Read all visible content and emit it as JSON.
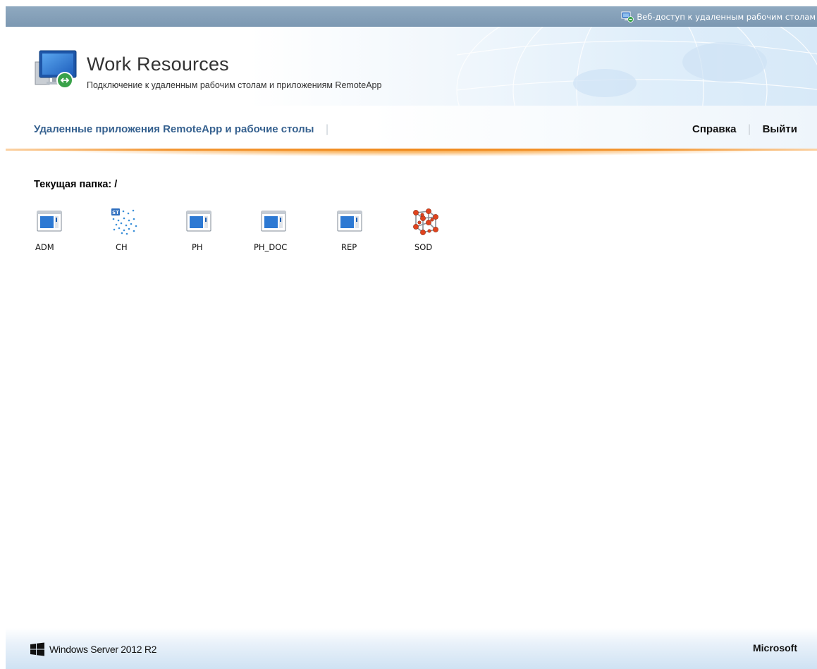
{
  "topbar": {
    "link_label": "Веб-доступ к удаленным рабочим столам",
    "icon": "remote-desktop-small-icon"
  },
  "header": {
    "title": "Work Resources",
    "subtitle": "Подключение к удаленным рабочим столам и приложениям RemoteApp",
    "logo_icon": "remote-desktop-monitor-icon"
  },
  "nav": {
    "main_label": "Удаленные приложения RemoteApp и рабочие столы",
    "help_label": "Справка",
    "logout_label": "Выйти"
  },
  "content": {
    "current_folder_label": "Текущая папка: /",
    "apps": [
      {
        "label": "ADM",
        "icon": "app-window-icon"
      },
      {
        "label": "CH",
        "icon": "st-dots-icon"
      },
      {
        "label": "PH",
        "icon": "app-window-icon"
      },
      {
        "label": "PH_DOC",
        "icon": "app-window-icon"
      },
      {
        "label": "REP",
        "icon": "app-window-icon"
      },
      {
        "label": "SOD",
        "icon": "molecule-cube-icon"
      }
    ]
  },
  "footer": {
    "os_label": "Windows Server 2012 R2",
    "brand_label": "Microsoft"
  },
  "colors": {
    "topbar": "#7c98b2",
    "nav_link": "#36618f",
    "accent_orange": "#f08a1e"
  }
}
